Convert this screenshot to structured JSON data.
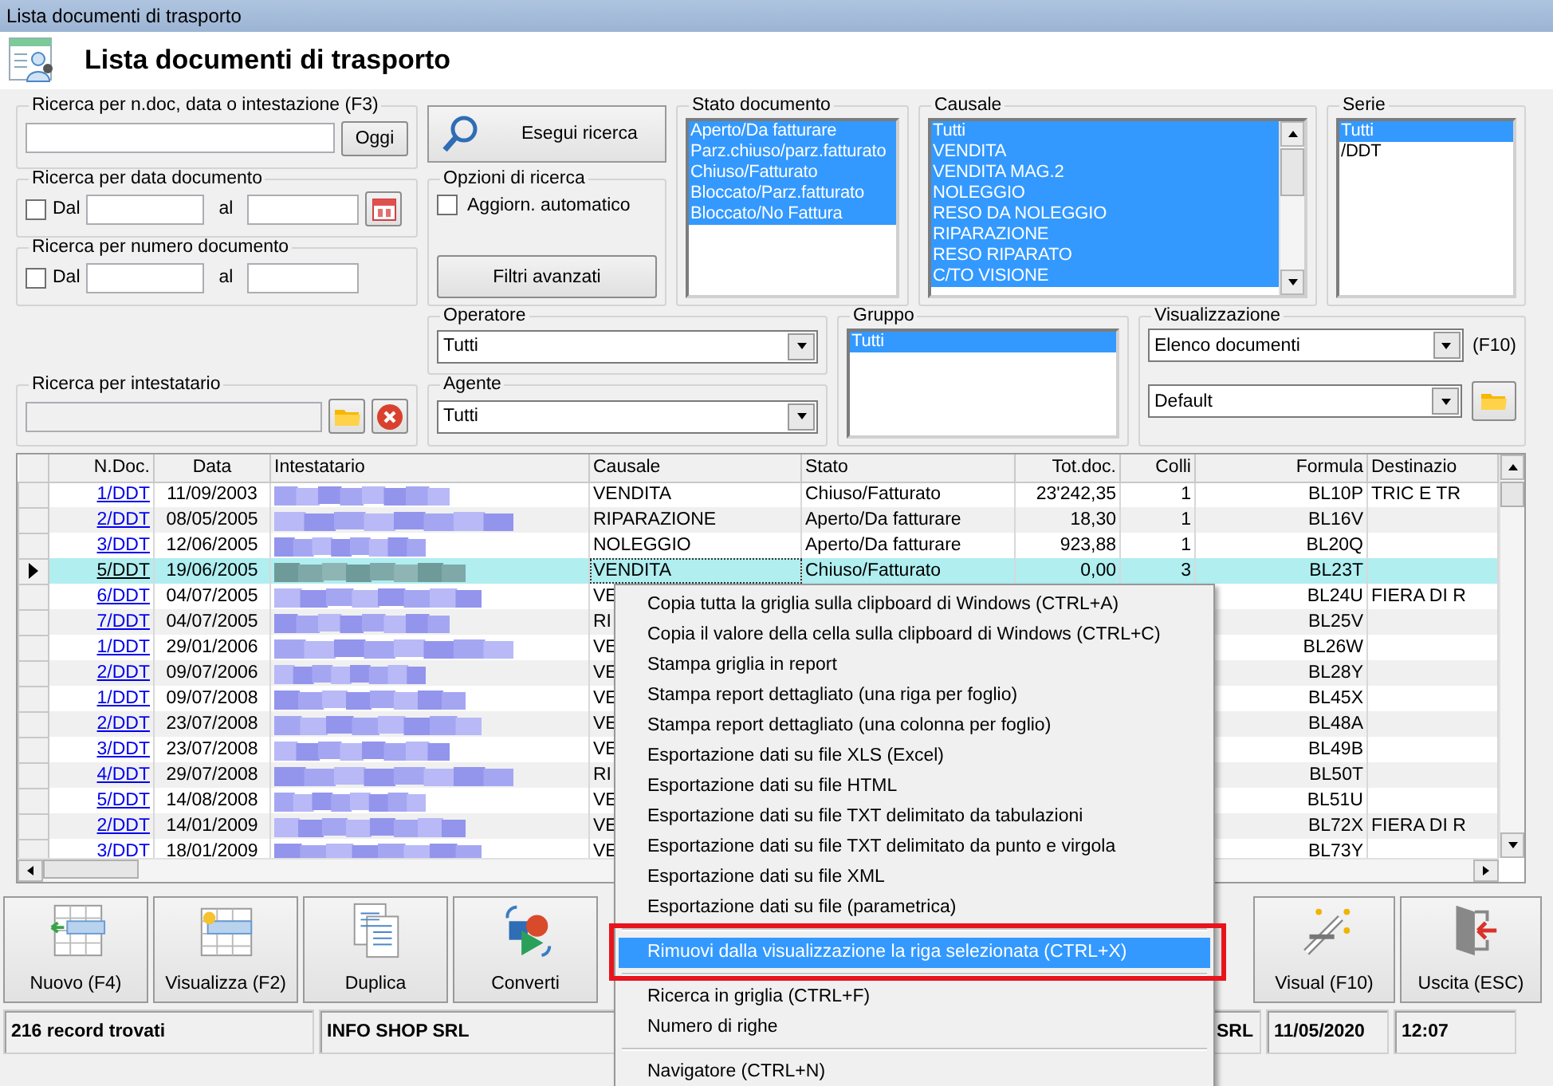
{
  "window": {
    "title": "Lista documenti di trasporto"
  },
  "header": {
    "title": "Lista documenti di trasporto"
  },
  "search_ndoc": {
    "label": "Ricerca per n.doc, data o intestazione (F3)",
    "button": "Oggi"
  },
  "search_date": {
    "label": "Ricerca per data documento",
    "checkbox": {
      "label": "Dal",
      "checked": false
    },
    "to_label": "al"
  },
  "search_number": {
    "label": "Ricerca per numero documento",
    "checkbox": {
      "label": "Dal",
      "checked": false
    },
    "to_label": "al"
  },
  "search_holder": {
    "label": "Ricerca per intestatario"
  },
  "run_search": {
    "label": "Esegui ricerca"
  },
  "options": {
    "label": "Opzioni di ricerca",
    "checkbox": {
      "label": "Aggiorn. automatico",
      "checked": false
    },
    "button": "Filtri avanzati"
  },
  "operatore": {
    "label": "Operatore",
    "value": "Tutti"
  },
  "agente": {
    "label": "Agente",
    "value": "Tutti"
  },
  "stato_documento": {
    "label": "Stato documento",
    "items": [
      {
        "text": "Aperto/Da fatturare",
        "selected": true
      },
      {
        "text": "Parz.chiuso/parz.fatturato",
        "selected": true
      },
      {
        "text": "Chiuso/Fatturato",
        "selected": true
      },
      {
        "text": "Bloccato/Parz.fatturato",
        "selected": true
      },
      {
        "text": "Bloccato/No Fattura",
        "selected": true
      }
    ]
  },
  "causale": {
    "label": "Causale",
    "items": [
      {
        "text": "Tutti",
        "selected": true
      },
      {
        "text": "VENDITA",
        "selected": true
      },
      {
        "text": "VENDITA MAG.2",
        "selected": true
      },
      {
        "text": "NOLEGGIO",
        "selected": true
      },
      {
        "text": "RESO DA NOLEGGIO",
        "selected": true
      },
      {
        "text": "RIPARAZIONE",
        "selected": true
      },
      {
        "text": "RESO RIPARATO",
        "selected": true
      },
      {
        "text": "C/TO VISIONE",
        "selected": true
      }
    ]
  },
  "serie": {
    "label": "Serie",
    "items": [
      {
        "text": "Tutti",
        "selected": true
      },
      {
        "text": "/DDT",
        "selected": false
      }
    ]
  },
  "gruppo": {
    "label": "Gruppo",
    "items": [
      {
        "text": "Tutti",
        "selected": true
      }
    ]
  },
  "visualizzazione": {
    "label": "Visualizzazione",
    "view": "Elenco documenti",
    "shortcut": "(F10)",
    "layout": "Default"
  },
  "table": {
    "columns": [
      "N.Doc.",
      "Data",
      "Intestatario",
      "Causale",
      "Stato",
      "Tot.doc.",
      "Colli",
      "Formula",
      "Destinazio"
    ],
    "rows": [
      {
        "n_doc": "1/DDT",
        "data": "11/09/2003",
        "causale": "VENDITA",
        "stato": "Chiuso/Fatturato",
        "tot_doc": "23'242,35",
        "colli": "1",
        "formula": "BL10P",
        "destinazione": "TRIC E TR",
        "selected": false
      },
      {
        "n_doc": "2/DDT",
        "data": "08/05/2005",
        "causale": "RIPARAZIONE",
        "stato": "Aperto/Da fatturare",
        "tot_doc": "18,30",
        "colli": "1",
        "formula": "BL16V",
        "selected": false
      },
      {
        "n_doc": "3/DDT",
        "data": "12/06/2005",
        "causale": "NOLEGGIO",
        "stato": "Aperto/Da fatturare",
        "tot_doc": "923,88",
        "colli": "1",
        "formula": "BL20Q",
        "selected": false
      },
      {
        "n_doc": "5/DDT",
        "data": "19/06/2005",
        "causale": "VENDITA",
        "stato": "Chiuso/Fatturato",
        "tot_doc": "0,00",
        "colli": "3",
        "formula": "BL23T",
        "selected": true
      },
      {
        "n_doc": "6/DDT",
        "data": "04/07/2005",
        "causale": "VE",
        "formula": "BL24U",
        "destinazione": "FIERA DI R",
        "selected": false
      },
      {
        "n_doc": "7/DDT",
        "data": "04/07/2005",
        "causale": "RI",
        "formula": "BL25V",
        "selected": false
      },
      {
        "n_doc": "1/DDT",
        "data": "29/01/2006",
        "causale": "VE",
        "formula": "BL26W",
        "selected": false
      },
      {
        "n_doc": "2/DDT",
        "data": "09/07/2006",
        "causale": "VE",
        "formula": "BL28Y",
        "selected": false
      },
      {
        "n_doc": "1/DDT",
        "data": "09/07/2008",
        "causale": "VE",
        "formula": "BL45X",
        "selected": false
      },
      {
        "n_doc": "2/DDT",
        "data": "23/07/2008",
        "causale": "VE",
        "formula": "BL48A",
        "selected": false
      },
      {
        "n_doc": "3/DDT",
        "data": "23/07/2008",
        "causale": "VE",
        "formula": "BL49B",
        "selected": false
      },
      {
        "n_doc": "4/DDT",
        "data": "29/07/2008",
        "causale": "RI",
        "formula": "BL50T",
        "selected": false
      },
      {
        "n_doc": "5/DDT",
        "data": "14/08/2008",
        "causale": "VE",
        "formula": "BL51U",
        "selected": false
      },
      {
        "n_doc": "2/DDT",
        "data": "14/01/2009",
        "causale": "VE",
        "formula": "BL72X",
        "destinazione": "FIERA DI R",
        "selected": false
      },
      {
        "n_doc": "3/DDT",
        "data": "18/01/2009",
        "causale": "VE",
        "formula": "BL73Y",
        "selected": false
      }
    ]
  },
  "context_menu": {
    "items": [
      {
        "kind": "item",
        "label": "Copia tutta la griglia sulla clipboard di Windows (CTRL+A)",
        "selected": false,
        "annotated": false
      },
      {
        "kind": "item",
        "label": "Copia il valore della cella sulla clipboard di Windows (CTRL+C)",
        "selected": false,
        "annotated": false
      },
      {
        "kind": "item",
        "label": "Stampa griglia in report",
        "selected": false,
        "annotated": false
      },
      {
        "kind": "item",
        "label": "Stampa report dettagliato (una riga per foglio)",
        "selected": false,
        "annotated": false
      },
      {
        "kind": "item",
        "label": "Stampa report dettagliato (una colonna per foglio)",
        "selected": false,
        "annotated": false
      },
      {
        "kind": "item",
        "label": "Esportazione dati su file XLS (Excel)",
        "selected": false,
        "annotated": false
      },
      {
        "kind": "item",
        "label": "Esportazione dati su file HTML",
        "selected": false,
        "annotated": false
      },
      {
        "kind": "item",
        "label": "Esportazione dati su file TXT delimitato da tabulazioni",
        "selected": false,
        "annotated": false
      },
      {
        "kind": "item",
        "label": "Esportazione dati su file TXT delimitato da punto e virgola",
        "selected": false,
        "annotated": false
      },
      {
        "kind": "item",
        "label": "Esportazione dati su file XML",
        "selected": false,
        "annotated": false
      },
      {
        "kind": "item",
        "label": "Esportazione dati su file (parametrica)",
        "selected": false,
        "annotated": false
      },
      {
        "kind": "separator"
      },
      {
        "kind": "item",
        "label": "Rimuovi dalla visualizzazione la riga selezionata (CTRL+X)",
        "selected": true,
        "annotated": true
      },
      {
        "kind": "separator"
      },
      {
        "kind": "item",
        "label": "Ricerca in griglia (CTRL+F)",
        "selected": false,
        "annotated": false
      },
      {
        "kind": "item",
        "label": "Numero di righe",
        "selected": false,
        "annotated": false
      },
      {
        "kind": "separator"
      },
      {
        "kind": "item",
        "label": "Navigatore (CTRL+N)",
        "selected": false,
        "annotated": false
      }
    ]
  },
  "toolbar": {
    "buttons_left": [
      {
        "kind": "new",
        "label": "Nuovo (F4)"
      },
      {
        "kind": "view",
        "label": "Visualizza (F2)"
      },
      {
        "kind": "duplicate",
        "label": "Duplica"
      },
      {
        "kind": "convert",
        "label": "Converti"
      }
    ],
    "buttons_right": [
      {
        "kind": "visual",
        "label": "Visual (F10)"
      },
      {
        "kind": "exit",
        "label": "Uscita (ESC)"
      }
    ]
  },
  "status_bar": {
    "panels": [
      "216 record trovati",
      "INFO SHOP SRL",
      "SRL",
      "11/05/2020",
      "12:07"
    ]
  }
}
